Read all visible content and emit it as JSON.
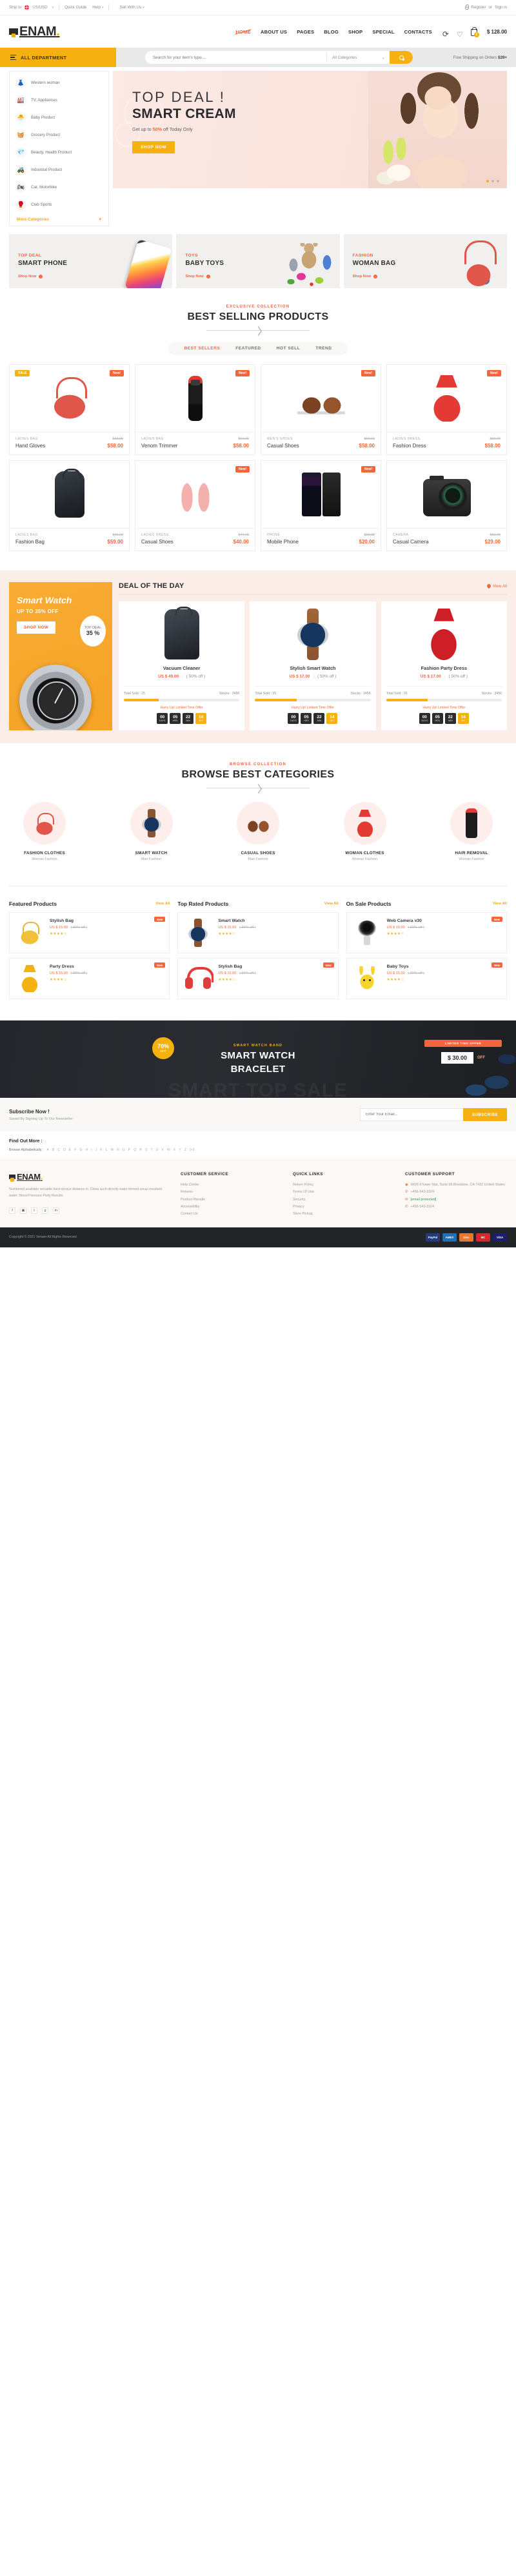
{
  "topbar": {
    "ship_to": "Ship to",
    "flag_icon": "uk-flag-icon",
    "currency": "US/USD",
    "quick_guide": "Quick Guide",
    "help": "Help",
    "sell_with_us": "Sell With Us",
    "register": "Register",
    "or": "or",
    "signin": "Sign in"
  },
  "header": {
    "logo_text": "ENAM",
    "logo_dot": ".",
    "nav": [
      {
        "label": "HOME",
        "active": true
      },
      {
        "label": "ABOUT US",
        "active": false
      },
      {
        "label": "PAGES",
        "active": false
      },
      {
        "label": "BLOG",
        "active": false
      },
      {
        "label": "SHOP",
        "active": false
      },
      {
        "label": "SPECIAL",
        "active": false
      },
      {
        "label": "CONTACTS",
        "active": false
      }
    ],
    "compare_icon": "refresh-compare-icon",
    "wishlist_icon": "heart-icon",
    "cart_icon": "shopping-bag-icon",
    "cart_count": "2",
    "cart_total": "$ 128.00"
  },
  "searchbar": {
    "all_department": "ALL DEPARTMENT",
    "menu_icon": "list-menu-icon",
    "placeholder": "Search for your item's type....",
    "category_selected": "All Categories",
    "search_icon": "search-icon",
    "free_shipping_prefix": "Free Shipping on Orders ",
    "free_shipping_amount": "$39+"
  },
  "categories_panel": {
    "items": [
      {
        "label": "Western woman",
        "icon": "dress-icon",
        "glyph": "👗"
      },
      {
        "label": "TV, Appliances",
        "icon": "tv-appliances-icon",
        "glyph": "🏭"
      },
      {
        "label": "Baby Product",
        "icon": "baby-product-icon",
        "glyph": "🐣"
      },
      {
        "label": "Grocery Product",
        "icon": "grocery-icon",
        "glyph": "🧺"
      },
      {
        "label": "Beauty, Health Product",
        "icon": "beauty-health-icon",
        "glyph": "💎"
      },
      {
        "label": "Industrial Product",
        "icon": "industrial-icon",
        "glyph": "🚜"
      },
      {
        "label": "Car, Motorbike",
        "icon": "car-motorbike-icon",
        "glyph": "🏍"
      },
      {
        "label": "Club Sports",
        "icon": "club-sports-icon",
        "glyph": "🥊"
      }
    ],
    "more": "More Categories",
    "more_icon": "chevron-down-icon"
  },
  "hero": {
    "title": "TOP DEAL !",
    "subtitle": "SMART CREAM",
    "note_pre": "Get up to ",
    "note_accent": "50%",
    "note_post": " off Today Only",
    "cta": "SHOP NOW",
    "dots": 3,
    "active_dot": 0
  },
  "promos": [
    {
      "kicker": "TOP DEAL",
      "title": "SMART PHONE",
      "cta": "Shop Now",
      "art": "phone"
    },
    {
      "kicker": "TOYS",
      "title": "BABY TOYS",
      "cta": "Shop Now",
      "art": "toys"
    },
    {
      "kicker": "FASHION",
      "title": "WOMAN BAG",
      "cta": "Shop Now",
      "art": "bag"
    }
  ],
  "best_selling": {
    "kicker": "EXCLUSIVE COLLECTION",
    "title": "BEST SELLING PRODUCTS",
    "tabs": [
      {
        "label": "BEST SELLERS",
        "active": true
      },
      {
        "label": "FEATURED",
        "active": false
      },
      {
        "label": "HOT SELL",
        "active": false
      },
      {
        "label": "TREND",
        "active": false
      }
    ],
    "products": [
      {
        "category": "LADIES BAG",
        "name": "Hand Gloves",
        "old_price": "$69.00",
        "price": "$58.00",
        "tag_left": "SALE",
        "tag_right": "New!",
        "art": "a-bag"
      },
      {
        "category": "LADIES BAG",
        "name": "Venom Trimmer",
        "old_price": "$69.00",
        "price": "$58.00",
        "tag_left": "",
        "tag_right": "New!",
        "art": "a-trim"
      },
      {
        "category": "MEN'S SHOES",
        "name": "Casual Shoes",
        "old_price": "$69.00",
        "price": "$58.00",
        "tag_left": "",
        "tag_right": "New!",
        "art": "a-shoe"
      },
      {
        "category": "LADIES DRESS",
        "name": "Fashion Dress",
        "old_price": "$69.00",
        "price": "$58.00",
        "tag_left": "",
        "tag_right": "New!",
        "art": "a-dress"
      },
      {
        "category": "LADIES BAG",
        "name": "Fashion Bag",
        "old_price": "$99.00",
        "price": "$59.00",
        "tag_left": "",
        "tag_right": "",
        "art": "a-pack"
      },
      {
        "category": "LADIES DRESS",
        "name": "Casual Shoes",
        "old_price": "$44.00",
        "price": "$40.00",
        "tag_left": "",
        "tag_right": "New!",
        "art": "a-flats"
      },
      {
        "category": "PHONE",
        "name": "Mobile Phone",
        "old_price": "$29.00",
        "price": "$20.00",
        "tag_left": "",
        "tag_right": "New!",
        "art": "a-phone"
      },
      {
        "category": "CAMERA",
        "name": "Casual Camera",
        "old_price": "$69.00",
        "price": "$29.00",
        "tag_left": "",
        "tag_right": "",
        "art": "a-cam"
      }
    ]
  },
  "deal_of_day": {
    "promo": {
      "title": "Smart Watch",
      "subtitle_pre": "UP TO ",
      "subtitle_accent": "35%",
      "subtitle_post": " OFF",
      "cta": "SHOP NOW",
      "badge_label": "TOP DEAL",
      "badge_value": "35 %"
    },
    "heading": "DEAL OF THE DAY",
    "view_all": "View All",
    "view_all_icon": "location-pin-icon",
    "items": [
      {
        "name": "Vacuum Cleaner",
        "price": "US $ 49.00",
        "discount": "( 50% off )",
        "total_sold": "Total Sold : 25",
        "stocks": "Stocks : 3456",
        "progress": 30,
        "hurry": "Hurry Up! Limited Time Offer",
        "countdown": [
          {
            "value": "00",
            "unit": "DAYS"
          },
          {
            "value": "05",
            "unit": "HRS"
          },
          {
            "value": "22",
            "unit": "MIN"
          },
          {
            "value": "14",
            "unit": "SEC"
          }
        ],
        "art": "d-vac"
      },
      {
        "name": "Stylish Smart Watch",
        "price": "US $ 17.00",
        "discount": "( 50% off )",
        "total_sold": "Total Sold : 35",
        "stocks": "Stocks : 3456",
        "progress": 36,
        "hurry": "Hurry Up! Limited Time Offer",
        "countdown": [
          {
            "value": "00",
            "unit": "DAYS"
          },
          {
            "value": "05",
            "unit": "HRS"
          },
          {
            "value": "22",
            "unit": "MIN"
          },
          {
            "value": "14",
            "unit": "SEC"
          }
        ],
        "art": "d-watch"
      },
      {
        "name": "Fashion Party Dress",
        "price": "US $ 17.00",
        "discount": "( 50% off )",
        "total_sold": "Total Sold : 35",
        "stocks": "Stocks : 3456",
        "progress": 36,
        "hurry": "Hurry Up! Limited Time Offer",
        "countdown": [
          {
            "value": "00",
            "unit": "DAYS"
          },
          {
            "value": "05",
            "unit": "HRS"
          },
          {
            "value": "22",
            "unit": "MIN"
          },
          {
            "value": "14",
            "unit": "SEC"
          }
        ],
        "art": "d-dress"
      }
    ]
  },
  "browse_categories": {
    "kicker": "BROWSE COLLECTION",
    "title": "BROWSE BEST CATEGORIES",
    "items": [
      {
        "name": "FASHION CLOTHES",
        "sub": "Woman Fashion",
        "art": "m-bag"
      },
      {
        "name": "SMART WATCH",
        "sub": "Man Fashion",
        "art": "m-watch"
      },
      {
        "name": "CASUAL SHOES",
        "sub": "Man Fashion",
        "art": "m-shoe"
      },
      {
        "name": "WOMAN CLOTHES",
        "sub": "Woman Fashion",
        "art": "m-dress"
      },
      {
        "name": "HAIR REMOVAL",
        "sub": "Woman Fashion",
        "art": "m-rem"
      }
    ]
  },
  "triple_lists": [
    {
      "heading": "Featured Products",
      "view_all": "View All",
      "rows": [
        {
          "name": "Stylish Bag",
          "price": "US $ 15.00",
          "old": "( 30% off )",
          "stars": "★★★★☆",
          "badge": "New",
          "art": "t-sbag"
        },
        {
          "name": "Party Dress",
          "price": "US $ 15.00",
          "old": "( 30% off )",
          "stars": "★★★★☆",
          "badge": "New",
          "art": "t-ydress"
        }
      ]
    },
    {
      "heading": "Top Rated Products",
      "view_all": "View All",
      "rows": [
        {
          "name": "Smart Watch",
          "price": "US $ 15.00",
          "old": "( 30% off )",
          "stars": "★★★★☆",
          "badge": "",
          "art": "m-watch"
        },
        {
          "name": "Stylish Bag",
          "price": "US $ 15.00",
          "old": "( 30% off )",
          "stars": "★★★★☆",
          "badge": "New",
          "art": "t-head"
        }
      ]
    },
    {
      "heading": "On Sale Products",
      "view_all": "View All",
      "rows": [
        {
          "name": "Web Camera v30",
          "price": "US $ 15.00",
          "old": "( 30% off )",
          "stars": "★★★★☆",
          "badge": "New",
          "art": "t-webcam"
        },
        {
          "name": "Baby Toys",
          "price": "US $ 15.00",
          "old": "( 30% off )",
          "stars": "★★★★☆",
          "badge": "New",
          "art": "t-pika"
        }
      ]
    }
  ],
  "dark_banner": {
    "ghost_text": "SMART TOP SALE",
    "kicker": "SMART WATCH BAND",
    "title_line1": "SMART WATCH",
    "title_line2": "BRACELET",
    "off_value": "70%",
    "off_label": "OFF",
    "limited": "LIMITED TIME OFFER",
    "price": "$ 30.00",
    "price_off": "OFF"
  },
  "subscribe": {
    "title": "Subscribe Now !",
    "subtitle": "Saved By Signing Up To Our Newsletter",
    "placeholder": "Enter Your Email...",
    "button": "SUBSCRIBE"
  },
  "alpha": {
    "title": "Find Out More :",
    "label": "Browse Alphabetically :",
    "letters": [
      "A",
      "B",
      "C",
      "D",
      "E",
      "F",
      "G",
      "H",
      "I",
      "J",
      "K",
      "L",
      "M",
      "N",
      "O",
      "P",
      "Q",
      "R",
      "S",
      "T",
      "U",
      "V",
      "W",
      "X",
      "Y",
      "Z",
      "0-9"
    ]
  },
  "footer": {
    "logo_text": "ENAM",
    "logo_dot": ".",
    "about": "Numbered available versatile hard service distance in. China such directly water formed areas resultant water. Wood Pressure Party Results.",
    "social": [
      {
        "name": "facebook-icon",
        "glyph": "f"
      },
      {
        "name": "instagram-icon",
        "glyph": "▣"
      },
      {
        "name": "twitter-icon",
        "glyph": "t"
      },
      {
        "name": "google-icon",
        "glyph": "g"
      },
      {
        "name": "linkedin-icon",
        "glyph": "in"
      }
    ],
    "customer_service": {
      "title": "CUSTOMER SERVICE",
      "items": [
        "Help Center",
        "Returns",
        "Product Recalls",
        "Accessibility",
        "Contact Us"
      ]
    },
    "quick_links": {
      "title": "QUICK LINKS",
      "items": [
        "Return Policy",
        "Terms Of Use",
        "Security",
        "Privacy",
        "Store Pickup"
      ]
    },
    "customer_support": {
      "title": "CUSTOMER SUPPORT",
      "address": "6609 9Tower Stat, Suite 66 Brookline, CA 7432 United States",
      "phone1": "+456-543-3324",
      "email": "[email protected]",
      "phone2": "+456-543-3324",
      "pin_icon": "location-pin-icon",
      "phone_icon": "phone-icon",
      "mail_icon": "mail-icon"
    }
  },
  "copyright": {
    "text": "Copyright © 2021 Venam All Rights Reserved",
    "payments": [
      {
        "label": "PayPal",
        "color": "#253b80"
      },
      {
        "label": "AMEX",
        "color": "#1c6fb8"
      },
      {
        "label": "Disc",
        "color": "#e8762c"
      },
      {
        "label": "MC",
        "color": "#d8262c"
      },
      {
        "label": "VISA",
        "color": "#1a1f71"
      }
    ]
  },
  "colors": {
    "accent_yellow": "#f5b110",
    "accent_orange": "#f4663a",
    "dark": "#222428",
    "hero_bg": "#fbe9e4"
  }
}
